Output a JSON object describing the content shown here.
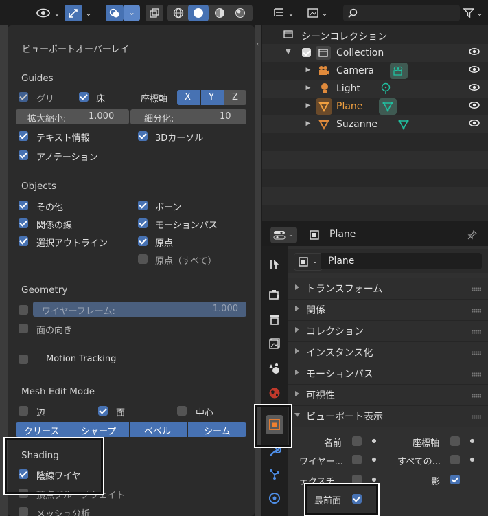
{
  "viewport_header": {
    "icons": [
      "eye-icon",
      "chevron-down-icon",
      "gizmo-icon",
      "chevron-down-icon",
      "overlay-icon",
      "chevron-down-icon",
      "xray-icon",
      "wireframe-shading-icon",
      "solid-shading-icon",
      "material-shading-icon",
      "rendered-shading-icon"
    ]
  },
  "overlay_popup": {
    "title": "ビューポートオーバーレイ",
    "guides": {
      "heading": "Guides",
      "grid": "グリ",
      "floor": "床",
      "axes_label": "座標軸",
      "x": "X",
      "y": "Y",
      "z": "Z",
      "scale_label": "拡大縮小:",
      "scale_value": "1.000",
      "subdiv_label": "細分化:",
      "subdiv_value": "10",
      "text_info": "テキスト情報",
      "cursor_3d": "3Dカーソル",
      "annotation": "アノテーション"
    },
    "objects": {
      "heading": "Objects",
      "extras": "その他",
      "bones": "ボーン",
      "relationship_lines": "関係の線",
      "motion_paths": "モーションパス",
      "outline_selected": "選択アウトライン",
      "origins": "原点",
      "origins_all": "原点（すべて）"
    },
    "geometry": {
      "heading": "Geometry",
      "wireframe_label": "ワイヤーフレーム:",
      "wireframe_value": "1.000",
      "face_orientation": "面の向き"
    },
    "motion_tracking": "Motion Tracking",
    "mesh_edit": {
      "heading": "Mesh Edit Mode",
      "edge": "辺",
      "face": "面",
      "center": "中心",
      "crease": "クリース",
      "sharp": "シャープ",
      "bevel": "ベベル",
      "seam": "シーム"
    },
    "shading": {
      "heading": "Shading",
      "wireframe": "陰線ワイヤ",
      "vertex_group_weights": "頂点グループウェイト",
      "mesh_analysis": "メッシュ分析"
    }
  },
  "outliner": {
    "header_icons": [
      "display-mode-icon",
      "chevron-down-icon",
      "filter-view-icon",
      "chevron-down-icon",
      "search-icon",
      "funnel-icon",
      "chevron-down-icon"
    ],
    "scene_collection": "シーンコレクション",
    "items": [
      {
        "label": "Collection"
      },
      {
        "label": "Camera"
      },
      {
        "label": "Light"
      },
      {
        "label": "Plane"
      },
      {
        "label": "Suzanne"
      }
    ]
  },
  "properties": {
    "object_name_header": "Plane",
    "object_name_field": "Plane",
    "panels": [
      "トランスフォーム",
      "関係",
      "コレクション",
      "インスタンス化",
      "モーションパス",
      "可視性",
      "ビューポート表示"
    ],
    "viewport_display": {
      "name": "名前",
      "axes": "座標軸",
      "wire": "ワイヤー...",
      "all_edges": "すべての...",
      "texture_space": "テクスチ...",
      "shadow": "影",
      "in_front": "最前面"
    }
  },
  "colors": {
    "accent": "#4772b3",
    "active_object": "#f0a040",
    "camera_icon": "#e08a3b",
    "mesh_icon": "#20c0a0"
  }
}
